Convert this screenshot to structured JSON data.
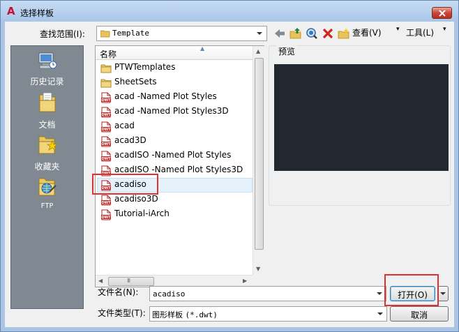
{
  "window": {
    "title": "选择样板",
    "app_icon": "autocad-a-icon",
    "close_icon": "close-icon"
  },
  "toolbar": {
    "look_in_label": "查找范围(I):",
    "look_in_value": "Template",
    "back_icon": "back-arrow-icon",
    "up_icon": "up-one-level-folder-icon",
    "search_web_icon": "search-web-icon",
    "delete_icon": "delete-x-icon",
    "new_folder_icon": "new-folder-icon",
    "views_label": "查看(V)",
    "tools_label": "工具(L)"
  },
  "places": [
    {
      "label": "历史记录",
      "icon": "history-computer-icon"
    },
    {
      "label": "文档",
      "icon": "documents-folder-icon"
    },
    {
      "label": "收藏夹",
      "icon": "favorites-folder-star-icon"
    },
    {
      "label": "FTP",
      "icon": "ftp-folder-globe-icon"
    }
  ],
  "filelist": {
    "column_header": "名称",
    "items": [
      {
        "name": "PTWTemplates",
        "icon": "folder-icon"
      },
      {
        "name": "SheetSets",
        "icon": "folder-icon"
      },
      {
        "name": "acad -Named Plot Styles",
        "icon": "dwt-file-icon"
      },
      {
        "name": "acad -Named Plot Styles3D",
        "icon": "dwt-file-icon"
      },
      {
        "name": "acad",
        "icon": "dwt-file-icon"
      },
      {
        "name": "acad3D",
        "icon": "dwt-file-icon"
      },
      {
        "name": "acadISO -Named Plot Styles",
        "icon": "dwt-file-icon"
      },
      {
        "name": "acadISO -Named Plot Styles3D",
        "icon": "dwt-file-icon"
      },
      {
        "name": "acadiso",
        "icon": "dwt-file-icon",
        "selected": true
      },
      {
        "name": "acadiso3D",
        "icon": "dwt-file-icon"
      },
      {
        "name": "Tutorial-iArch",
        "icon": "dwt-file-icon"
      }
    ],
    "dwt_badge": "DWT",
    "hscroll_grip": "III"
  },
  "preview": {
    "label": "预览",
    "background": "#212830"
  },
  "bottom": {
    "filename_label": "文件名(N):",
    "filename_value": "acadiso",
    "filetype_label": "文件类型(T):",
    "filetype_value_cn": "图形样板",
    "filetype_value_ext": "(*.dwt)",
    "open_label": "打开(O)",
    "cancel_label": "取消"
  },
  "colors": {
    "highlight": "#e03030",
    "title_bar": "#aac6e8",
    "places_bar": "#808891"
  }
}
